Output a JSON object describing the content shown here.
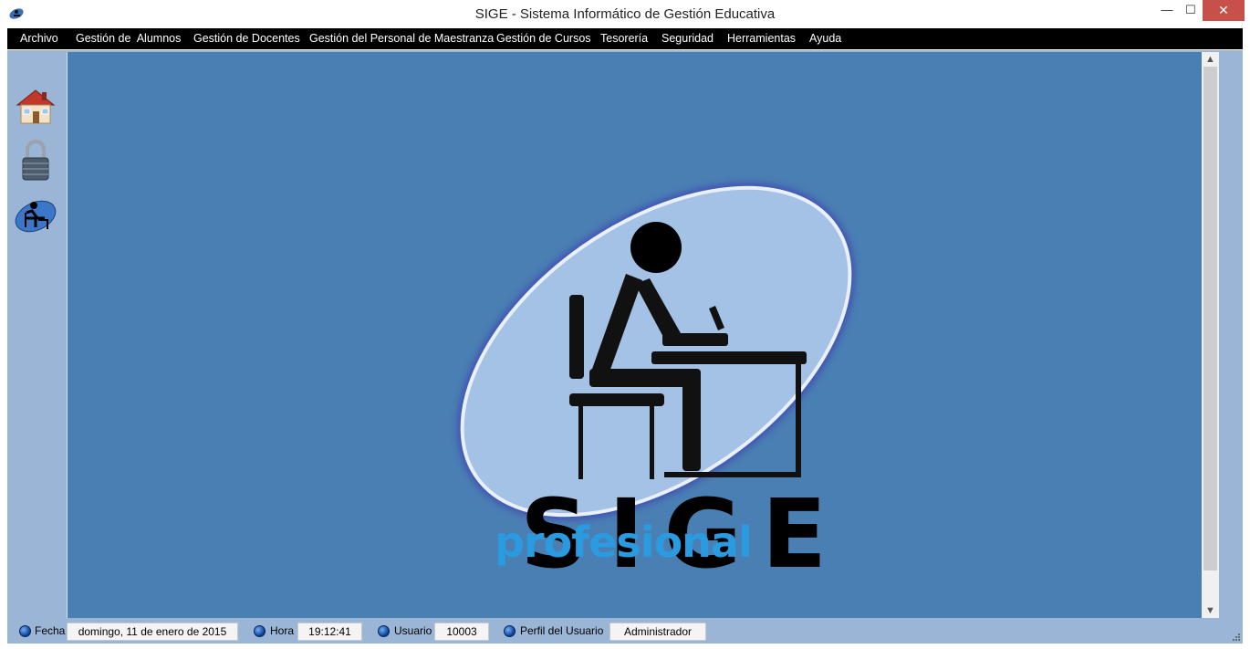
{
  "window": {
    "title": "SIGE - Sistema Informático de Gestión Educativa",
    "minimize": "—",
    "maximize": "☐",
    "close": "✕"
  },
  "menu": {
    "items": [
      "Archivo",
      "Gestión de  Alumnos",
      "Gestión de Docentes",
      "Gestión del Personal de Maestranza",
      "Gestión de Cursos",
      "Tesorería",
      "Seguridad",
      "Herramientas",
      "Ayuda"
    ]
  },
  "toolbar": {
    "icons": [
      "home-icon",
      "padlock-icon",
      "student-desk-icon"
    ]
  },
  "logo": {
    "title": "SIGE",
    "subtitle": "profesional"
  },
  "status": {
    "fecha_label": "Fecha",
    "fecha_value": "domingo, 11 de enero de 2015",
    "hora_label": "Hora",
    "hora_value": "19:12:41",
    "usuario_label": "Usuario",
    "usuario_value": "10003",
    "perfil_label": "Perfil del Usuario",
    "perfil_value": "Administrador"
  },
  "colors": {
    "main_bg": "#4a7fb3",
    "frame": "#9bb5d6",
    "menubar": "#000000",
    "subtitle": "#2a9be0"
  }
}
